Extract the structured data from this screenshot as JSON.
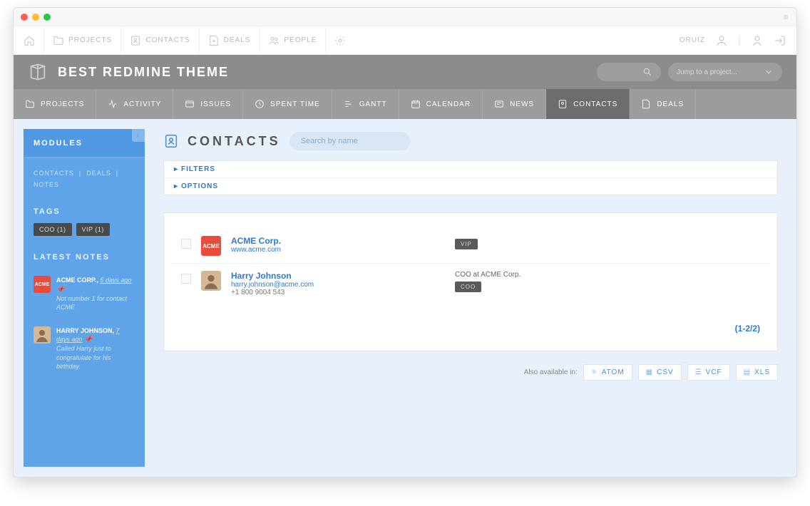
{
  "topnav": {
    "items": [
      "PROJECTS",
      "CONTACTS",
      "DEALS",
      "PEOPLE"
    ],
    "user": "ORUIZ"
  },
  "banner": {
    "title": "BEST REDMINE THEME",
    "jump_placeholder": "Jump to a project..."
  },
  "tabs": [
    "PROJECTS",
    "ACTIVITY",
    "ISSUES",
    "SPENT TIME",
    "GANTT",
    "CALENDAR",
    "NEWS",
    "CONTACTS",
    "DEALS"
  ],
  "active_tab": "CONTACTS",
  "sidebar": {
    "modules_label": "MODULES",
    "links": [
      "CONTACTS",
      "DEALS",
      "NOTES"
    ],
    "tags_label": "TAGS",
    "tags": [
      {
        "label": "COO",
        "count": "(1)"
      },
      {
        "label": "VIP",
        "count": "(1)"
      }
    ],
    "latest_label": "LATEST NOTES",
    "notes": [
      {
        "avatar": "ACME",
        "avatar_type": "acme",
        "who": "ACME CORP.",
        "when": "5 days ago",
        "text": "Not number 1 for contact ACME"
      },
      {
        "avatar": "",
        "avatar_type": "person",
        "who": "HARRY JOHNSON",
        "when": "7 days ago",
        "text": "Called Harry just to congratulate for his birthday."
      }
    ]
  },
  "page": {
    "title": "CONTACTS",
    "search_placeholder": "Search by name",
    "filters_label": "FILTERS",
    "options_label": "OPTIONS",
    "pager": "(1-2/2)",
    "also_label": "Also available in:"
  },
  "contacts": [
    {
      "avatar": "ACME",
      "avtype": "acme",
      "name": "ACME Corp.",
      "sub": "www.acme.com",
      "phone": "",
      "role": "",
      "badge": "VIP"
    },
    {
      "avatar": "",
      "avtype": "person",
      "name": "Harry Johnson",
      "sub": "harry.johnson@acme.com",
      "phone": "+1 800 9004 543",
      "role": "COO at ACME Corp.",
      "badge": "COO"
    }
  ],
  "exports": [
    "ATOM",
    "CSV",
    "VCF",
    "XLS"
  ]
}
